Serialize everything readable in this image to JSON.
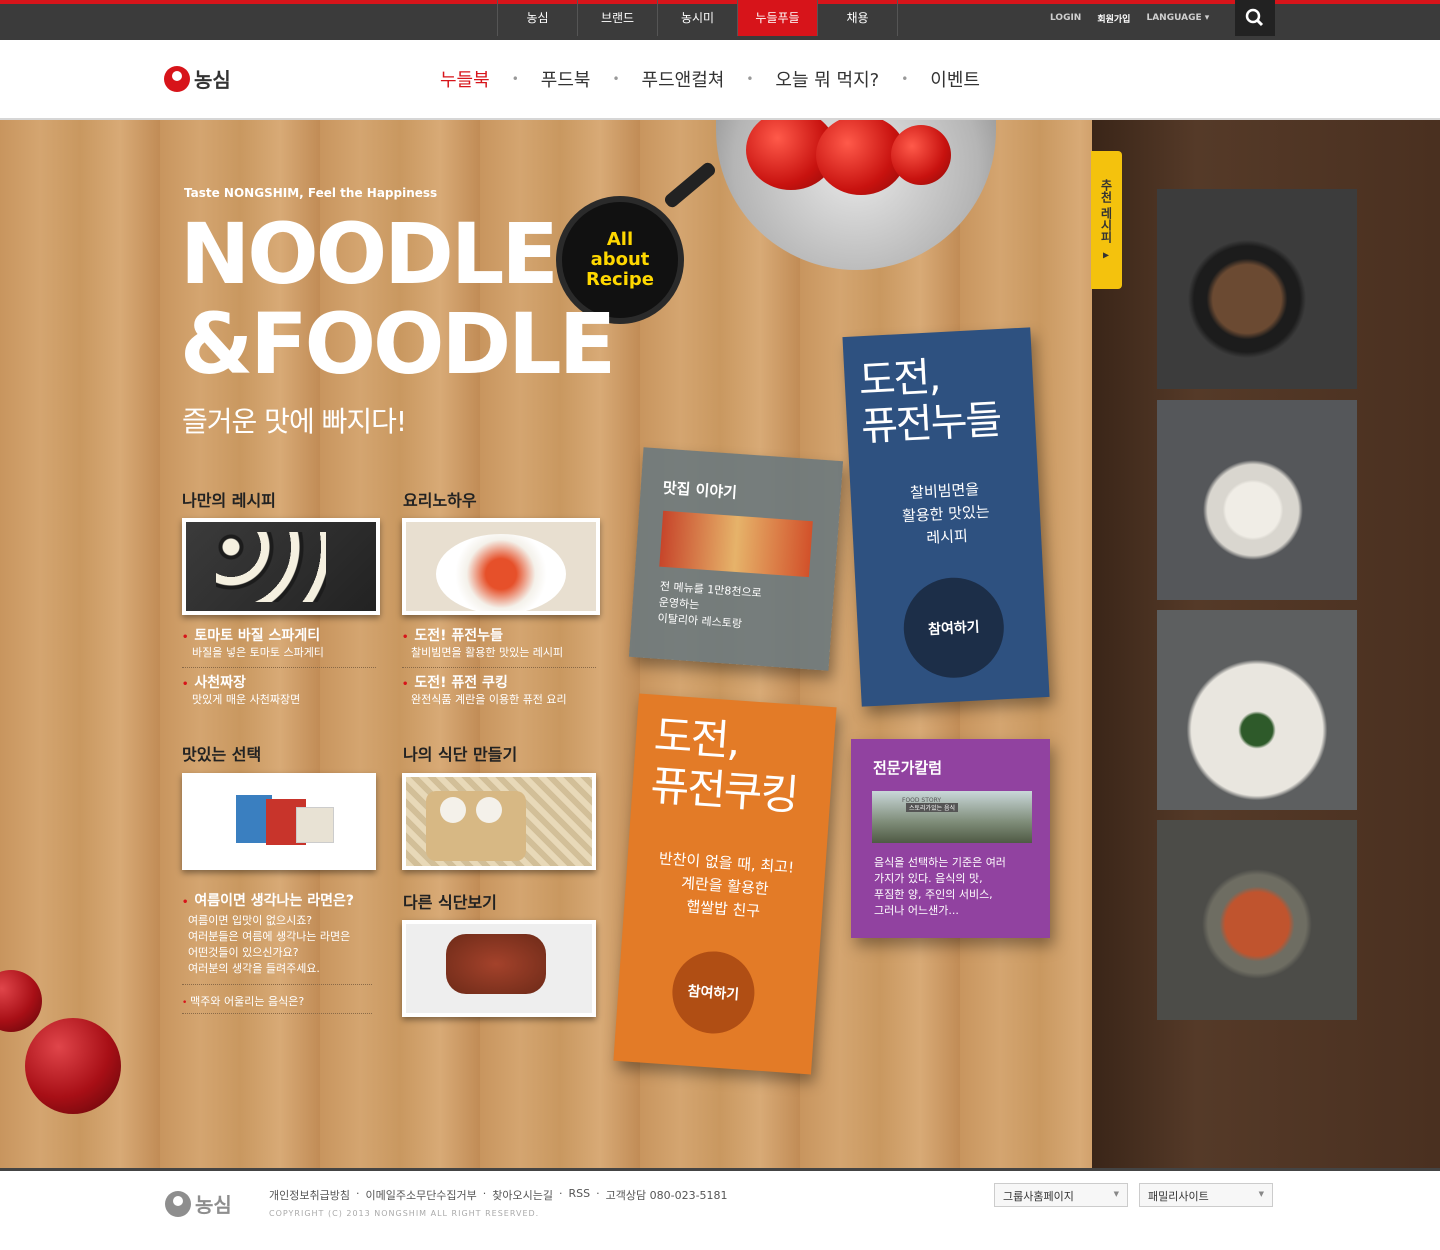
{
  "top": {
    "nav": [
      "농심",
      "브랜드",
      "농시미",
      "누들푸들",
      "채용"
    ],
    "active": 3,
    "links": [
      "LOGIN",
      "회원가입",
      "LANGUAGE ▾"
    ]
  },
  "brand": "농심",
  "mainnav": [
    "누들북",
    "푸드북",
    "푸드앤컬쳐",
    "오늘 뭐 먹지?",
    "이벤트"
  ],
  "hero": {
    "tagline": "Taste NONGSHIM, Feel the Happiness",
    "title1": "NOODLE",
    "title2": "&FOODLE",
    "subtitle": "즐거운 맛에 빠지다!",
    "badge": "All\nabout\nRecipe"
  },
  "sections": {
    "my_recipe": {
      "title": "나만의 레시피",
      "items": [
        {
          "t": "토마토 바질 스파게티",
          "s": "바질을 넣은 토마토 스파게티"
        },
        {
          "t": "사천짜장",
          "s": "맛있게 매운 사천짜장면"
        }
      ]
    },
    "knowhow": {
      "title": "요리노하우",
      "items": [
        {
          "t": "도전! 퓨전누들",
          "s": "찰비빔면을 활용한 맛있는 레시피"
        },
        {
          "t": "도전! 퓨전 쿠킹",
          "s": "완전식품 계란을 이용한 퓨전 요리"
        }
      ]
    },
    "choice": {
      "title": "맛있는 선택",
      "item": "여름이면 생각나는 라면은?",
      "lines": [
        "여름이면 입맛이 없으시죠?",
        "여러분들은 여름에 생각나는 라면은",
        "어떤것들이 있으신가요?",
        "여러분의 생각을 들려주세요."
      ],
      "item2": "맥주와 어울리는 음식은?"
    },
    "diet": {
      "title": "나의 식단 만들기"
    },
    "diet_other": {
      "title": "다른 식단보기"
    }
  },
  "cards": {
    "restaurant": {
      "title": "맛집 이야기",
      "lines": [
        "전 메뉴를 1만8천으로",
        "운영하는",
        "이탈리아 레스토랑"
      ]
    },
    "fusion_noodle": {
      "title1": "도전,",
      "title2": "퓨전누들",
      "lines": [
        "찰비빔면을",
        "활용한 맛있는",
        "레시피"
      ],
      "btn": "참여하기"
    },
    "fusion_cooking": {
      "title1": "도전,",
      "title2": "퓨전쿠킹",
      "lines": [
        "반찬이 없을 때, 최고!",
        "계란을 활용한",
        "햅쌀밥 친구"
      ],
      "btn": "참여하기"
    },
    "column": {
      "title": "전문가칼럼",
      "img_text": "스토리가있는 음식",
      "img_label": "FOOD STORY",
      "lines": [
        "음식을 선택하는 기준은 여러",
        "가지가 있다. 음식의 맛,",
        "푸짐한 양, 주인의 서비스,",
        "그러나 어느샌가..."
      ]
    }
  },
  "side_tab": "추천 레시피 ▸",
  "footer": {
    "links": [
      "개인정보취급방침",
      "·",
      "이메일주소무단수집거부",
      "·",
      "찾아오시는길",
      "·",
      "RSS",
      "·",
      "고객상담 080-023-5181"
    ],
    "copyright": "COPYRIGHT (C) 2013 NONGSHIM ALL RIGHT RESERVED.",
    "select1": "그룹사홈페이지",
    "select2": "패밀리사이트"
  }
}
